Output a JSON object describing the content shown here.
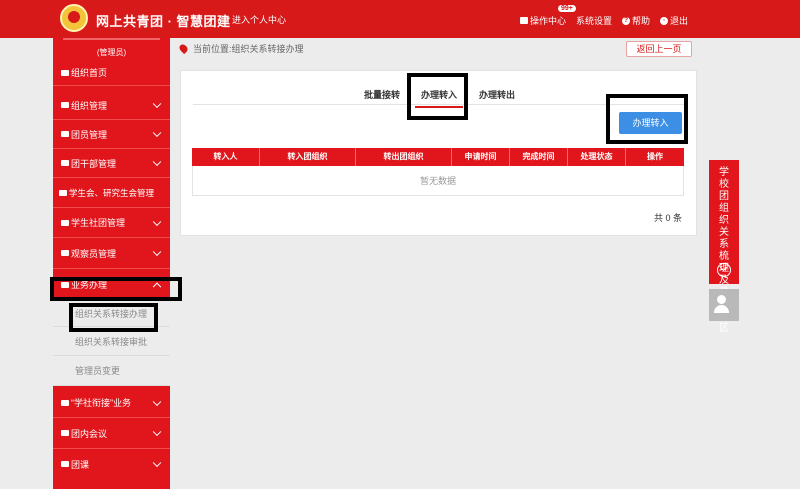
{
  "header": {
    "brand": "网上共青团 · 智慧团建",
    "personal_center": "进入个人中心",
    "menu": [
      {
        "label": "操作中心",
        "badge": "99+"
      },
      {
        "label": "系统设置"
      },
      {
        "label": "帮助"
      },
      {
        "label": "退出"
      }
    ]
  },
  "sidebar": {
    "user_role": "(管理员)",
    "items": [
      {
        "label": "组织首页"
      },
      {
        "label": "组织管理"
      },
      {
        "label": "团员管理"
      },
      {
        "label": "团干部管理"
      },
      {
        "label": "学生会、研究生会管理"
      },
      {
        "label": "学生社团管理"
      },
      {
        "label": "观察员管理"
      },
      {
        "label": "业务办理"
      },
      {
        "label": "“学社衔接”业务"
      },
      {
        "label": "团内会议"
      },
      {
        "label": "团课"
      }
    ],
    "subitems": [
      {
        "label": "组织关系转接办理"
      },
      {
        "label": "组织关系转接审批"
      },
      {
        "label": "管理员变更"
      }
    ]
  },
  "breadcrumb": "当前位置:组织关系转接办理",
  "back_button": "返回上一页",
  "tabs": [
    {
      "label": "批量接转"
    },
    {
      "label": "办理转入"
    },
    {
      "label": "办理转出"
    }
  ],
  "primary_button": "办理转入",
  "table": {
    "columns": [
      "转入人",
      "转入团组织",
      "转出团组织",
      "申请时间",
      "完成时间",
      "处理状态",
      "操作"
    ],
    "empty_text": "暂无数据",
    "total": "共 0 条"
  },
  "float_panel": {
    "label": "学校团组织关系梳理及录入专区"
  },
  "colors": {
    "primary_red": "#d7191a",
    "action_blue": "#3d8fe6"
  }
}
